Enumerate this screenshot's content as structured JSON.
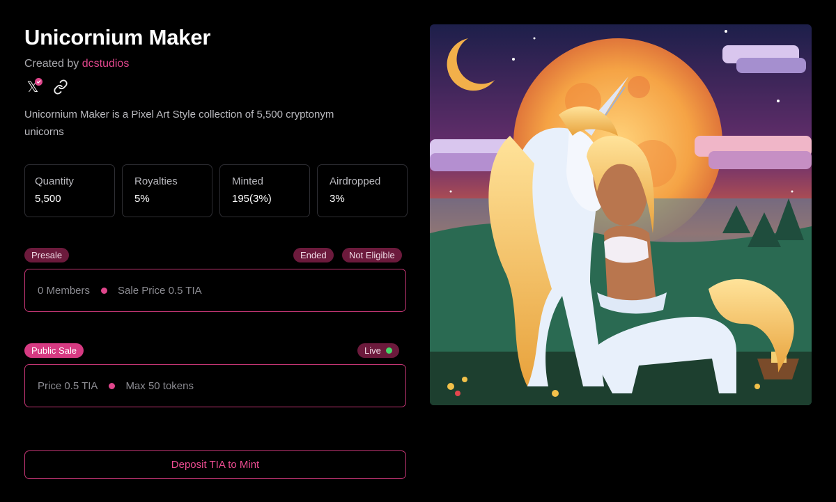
{
  "collection": {
    "title": "Unicornium Maker",
    "created_by_prefix": "Created by",
    "creator": "dcstudios",
    "description": "Unicornium Maker is a Pixel Art Style collection of 5,500 cryptonym unicorns"
  },
  "socials": [
    {
      "icon": "x-logo-icon",
      "glyph": "𝕏",
      "badge": "verified-badge-icon"
    },
    {
      "icon": "link-icon"
    }
  ],
  "stats": [
    {
      "label": "Quantity",
      "value": "5,500"
    },
    {
      "label": "Royalties",
      "value": "5%"
    },
    {
      "label": "Minted",
      "value": "195(3%)"
    },
    {
      "label": "Airdropped",
      "value": "3%"
    }
  ],
  "presale": {
    "label": "Presale",
    "badges": [
      "Ended",
      "Not Eligible"
    ],
    "members": "0 Members",
    "price": "Sale Price 0.5 TIA"
  },
  "public_sale": {
    "label": "Public Sale",
    "status": "Live",
    "price": "Price 0.5 TIA",
    "max": "Max 50 tokens"
  },
  "cta": {
    "label": "Deposit TIA to Mint"
  },
  "colors": {
    "accent": "#e0468c",
    "pill_dark": "#6c1a3c",
    "live": "#46d86a",
    "background": "#000000"
  }
}
